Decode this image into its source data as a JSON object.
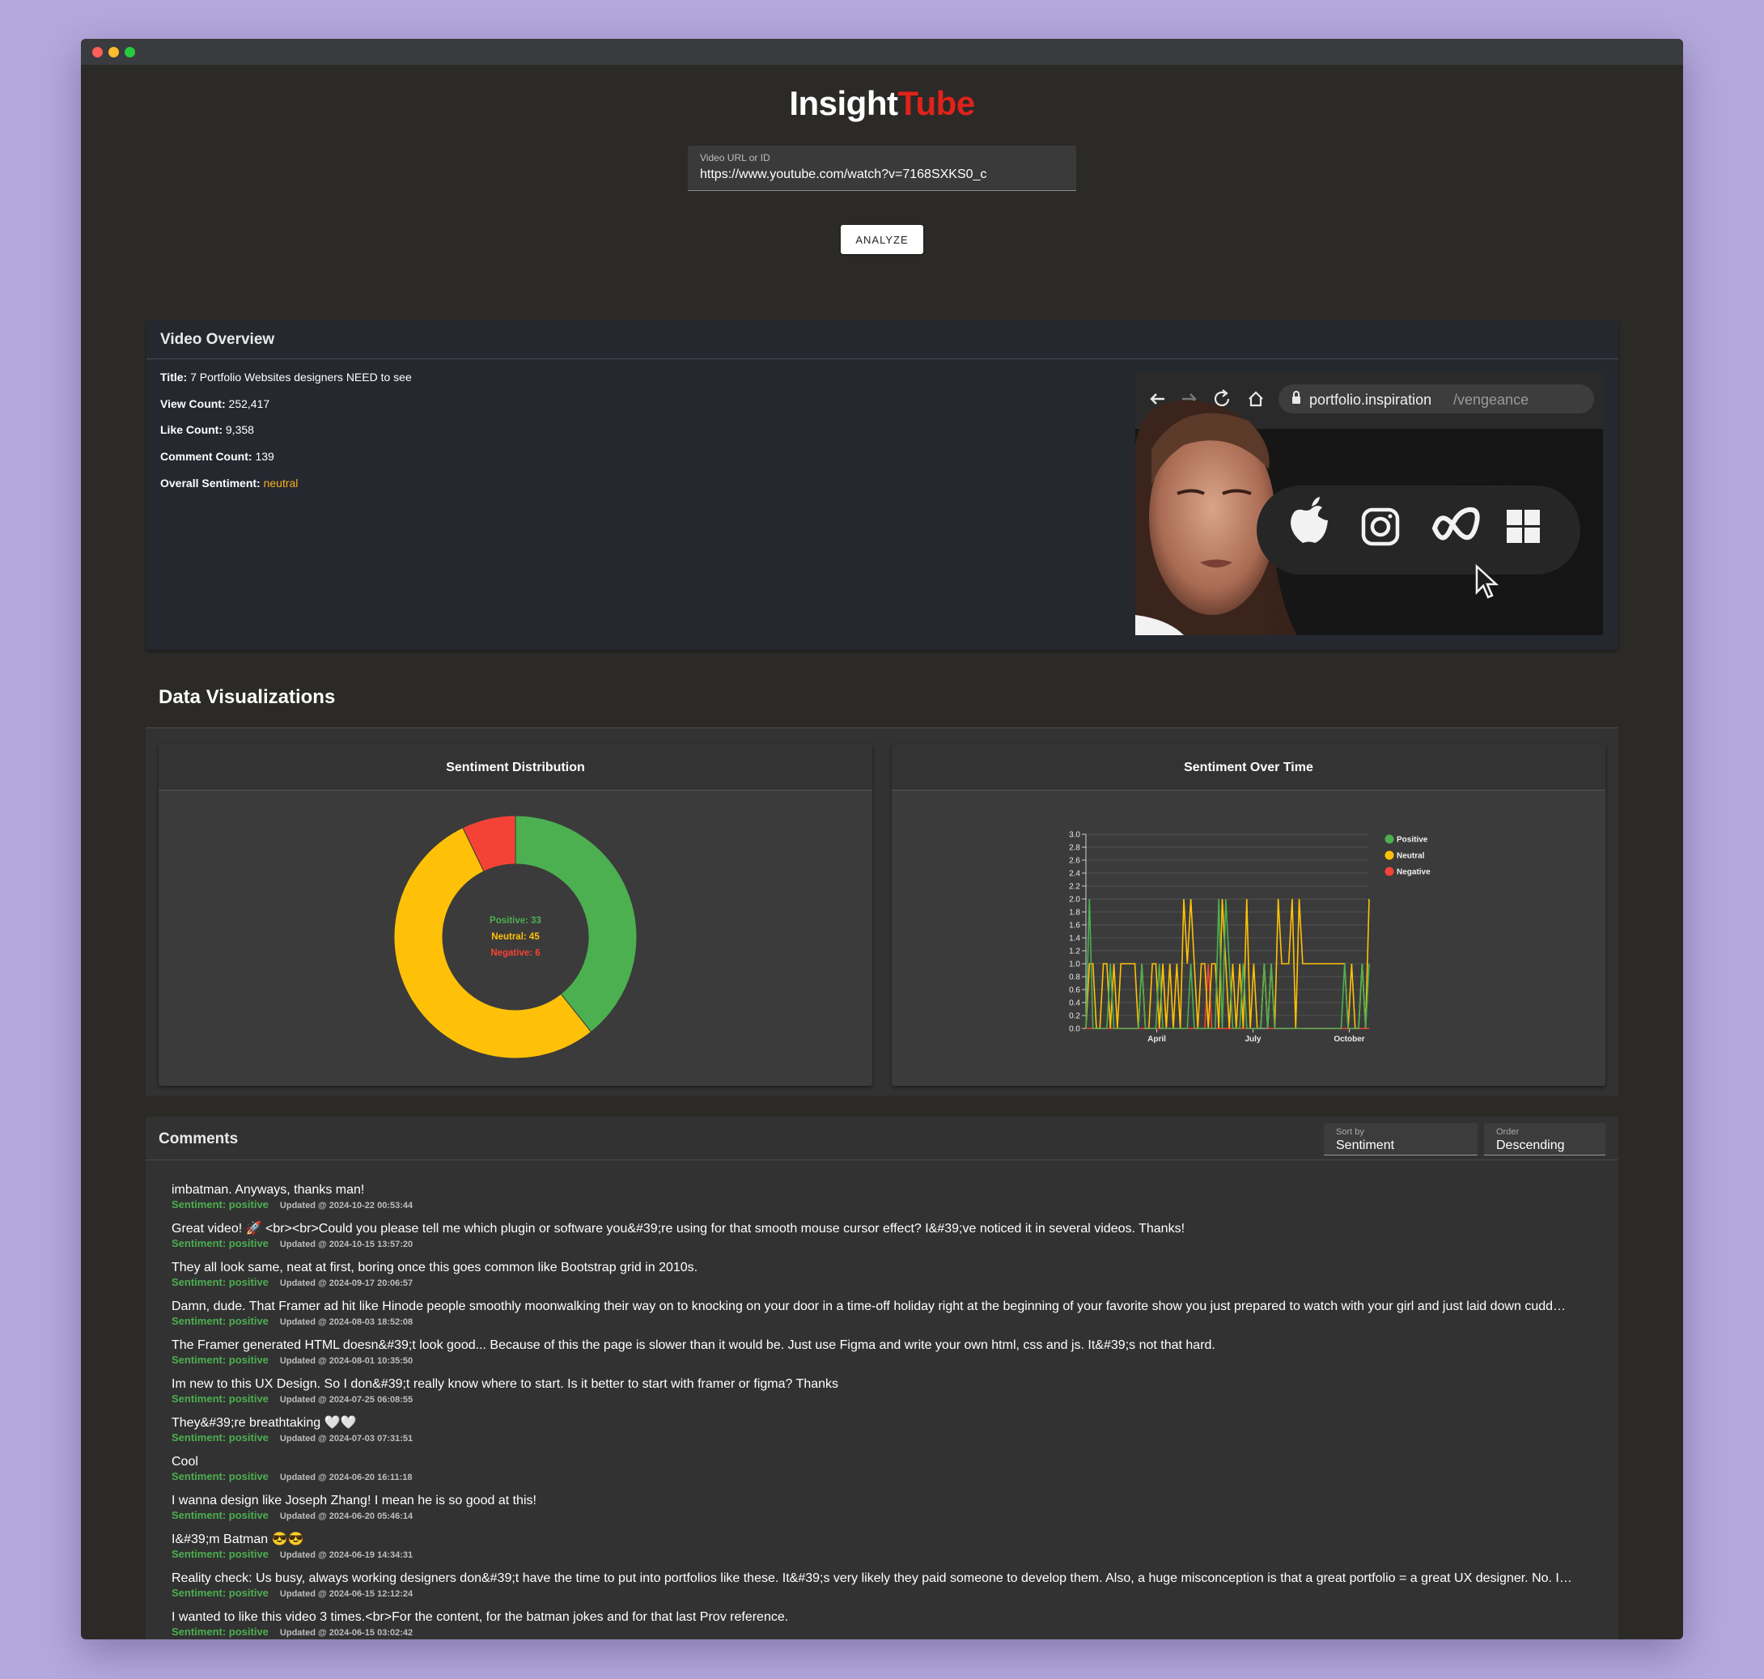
{
  "app": {
    "logo_a": "Insight",
    "logo_b": "Tube",
    "brand_red": "#e0221b"
  },
  "search": {
    "label": "Video URL or ID",
    "value": "https://www.youtube.com/watch?v=7168SXKS0_c",
    "button": "ANALYZE"
  },
  "overview": {
    "heading": "Video Overview",
    "title_label": "Title:",
    "title": "7 Portfolio Websites designers NEED to see",
    "views_label": "View Count:",
    "views": "252,417",
    "likes_label": "Like Count:",
    "likes": "9,358",
    "comments_label": "Comment Count:",
    "comments": "139",
    "sentiment_label": "Overall Sentiment:",
    "sentiment": "neutral",
    "thumbnail": {
      "address_host": "portfolio.inspiration",
      "address_path": "/vengeance",
      "icons": [
        "apple-icon",
        "instagram-icon",
        "meta-icon",
        "windows-icon",
        "cursor-icon"
      ]
    }
  },
  "viz": {
    "heading": "Data Visualizations"
  },
  "chart_data": [
    {
      "type": "pie",
      "title": "Sentiment Distribution",
      "categories": [
        "Positive",
        "Neutral",
        "Negative"
      ],
      "labels": [
        "Positive: 33",
        "Neutral: 45",
        "Negative: 6"
      ],
      "values": [
        33,
        45,
        6
      ],
      "colors": [
        "#4caf50",
        "#ffc107",
        "#f44336"
      ]
    },
    {
      "type": "line",
      "title": "Sentiment Over Time",
      "ylim": [
        0,
        3
      ],
      "yticks": [
        "0.0",
        "0.2",
        "0.4",
        "0.6",
        "0.8",
        "1.0",
        "1.2",
        "1.4",
        "1.6",
        "1.8",
        "2.0",
        "2.2",
        "2.4",
        "2.6",
        "2.8",
        "3.0"
      ],
      "xticks": [
        "April",
        "July",
        "October"
      ],
      "legend_position": "top-right",
      "grid": true,
      "series": [
        {
          "name": "Positive",
          "color": "#4caf50",
          "values": [
            0,
            2,
            0,
            0,
            0,
            0,
            0,
            1,
            0,
            0,
            0,
            0,
            0,
            0,
            0,
            0,
            1,
            0,
            0,
            0,
            0,
            1,
            0,
            0,
            0,
            0,
            0,
            0,
            0,
            0,
            1,
            0,
            0,
            0,
            0,
            0,
            0,
            0,
            2,
            0,
            2,
            1,
            0,
            0,
            0,
            1,
            0,
            0,
            0,
            0,
            0,
            1,
            0,
            1,
            0,
            0,
            0,
            0,
            0,
            0,
            0,
            0,
            0,
            0,
            0,
            0,
            0,
            0,
            0,
            0,
            0,
            0,
            0,
            0,
            1,
            0,
            0,
            0,
            0,
            1,
            0,
            1
          ]
        },
        {
          "name": "Neutral",
          "color": "#ffc107",
          "values": [
            0,
            1,
            1,
            0,
            0,
            1,
            1,
            0,
            1,
            0,
            1,
            1,
            1,
            1,
            1,
            0,
            1,
            0,
            0,
            1,
            1,
            0,
            1,
            0,
            1,
            0,
            1,
            0,
            2,
            1,
            2,
            1,
            0,
            1,
            1,
            0,
            1,
            1,
            0,
            2,
            1,
            0,
            1,
            0,
            1,
            0,
            2,
            0,
            1,
            0,
            0,
            1,
            0,
            1,
            0,
            2,
            1,
            1,
            1,
            2,
            0,
            2,
            1,
            1,
            1,
            1,
            1,
            1,
            1,
            1,
            1,
            1,
            1,
            1,
            1,
            0,
            1,
            0,
            0,
            1,
            0,
            2
          ]
        },
        {
          "name": "Negative",
          "color": "#f44336",
          "values": [
            0,
            0,
            0,
            0,
            0,
            0,
            0,
            0,
            0,
            0,
            0,
            0,
            0,
            0,
            0,
            0,
            0,
            0,
            0,
            0,
            0,
            0,
            1,
            0,
            0,
            0,
            0,
            0,
            0,
            0,
            0,
            0,
            0,
            0,
            0,
            1,
            0,
            0,
            0,
            0,
            0,
            0,
            0,
            0,
            0,
            0,
            0,
            0,
            0,
            0,
            0,
            1,
            0,
            0,
            0,
            0,
            0,
            0,
            0,
            0,
            0,
            0,
            0,
            0,
            0,
            0,
            0,
            0,
            0,
            0,
            0,
            0,
            0,
            0,
            0,
            0,
            0,
            0,
            0,
            0,
            0,
            0
          ]
        }
      ]
    }
  ],
  "comments": {
    "heading": "Comments",
    "sort_label": "Sort by",
    "sort_value": "Sentiment",
    "order_label": "Order",
    "order_value": "Descending",
    "items": [
      {
        "text": "imbatman. Anyways, thanks man!",
        "sentiment": "Sentiment: positive",
        "updated": "Updated @ 2024-10-22 00:53:44"
      },
      {
        "text": "Great video! 🚀 <br><br>Could you please tell me which plugin or software you&#39;re using for that smooth mouse cursor effect? I&#39;ve noticed it in several videos. Thanks!",
        "sentiment": "Sentiment: positive",
        "updated": "Updated @ 2024-10-15 13:57:20"
      },
      {
        "text": "They all look same, neat at first, boring once this goes common like Bootstrap grid in 2010s.",
        "sentiment": "Sentiment: positive",
        "updated": "Updated @ 2024-09-17 20:06:57"
      },
      {
        "text": "Damn, dude. That Framer ad hit like Hinode people smoothly moonwalking their way on to knocking on your door in a time-off holiday right at the beginning of your favorite show you just prepared to watch with your girl and just laid down cudd…",
        "sentiment": "Sentiment: positive",
        "updated": "Updated @ 2024-08-03 18:52:08"
      },
      {
        "text": "The Framer generated HTML doesn&#39;t look good... Because of this the page is slower than it would be. Just use Figma and write your own html, css and js. It&#39;s not that hard.",
        "sentiment": "Sentiment: positive",
        "updated": "Updated @ 2024-08-01 10:35:50"
      },
      {
        "text": "Im new to this UX Design. So I don&#39;t really know where to start. Is it better to start with framer or figma? Thanks",
        "sentiment": "Sentiment: positive",
        "updated": "Updated @ 2024-07-25 06:08:55"
      },
      {
        "text": "They&#39;re breathtaking 🤍🤍",
        "sentiment": "Sentiment: positive",
        "updated": "Updated @ 2024-07-03 07:31:51"
      },
      {
        "text": "Cool",
        "sentiment": "Sentiment: positive",
        "updated": "Updated @ 2024-06-20 16:11:18"
      },
      {
        "text": "I wanna design like Joseph Zhang! I mean he is so good at this!",
        "sentiment": "Sentiment: positive",
        "updated": "Updated @ 2024-06-20 05:46:14"
      },
      {
        "text": "I&#39;m Batman 😎😎",
        "sentiment": "Sentiment: positive",
        "updated": "Updated @ 2024-06-19 14:34:31"
      },
      {
        "text": "Reality check: Us busy, always working designers don&#39;t have the time to put into portfolios like these. It&#39;s very likely they paid someone to develop them. Also, a huge misconception is that a great portfolio = a great UX designer. No. I…",
        "sentiment": "Sentiment: positive",
        "updated": "Updated @ 2024-06-15 12:12:24"
      },
      {
        "text": "I wanted to like this video 3 times.<br>For the content, for the batman jokes and for that last Prov reference.",
        "sentiment": "Sentiment: positive",
        "updated": "Updated @ 2024-06-15 03:02:42"
      }
    ]
  }
}
